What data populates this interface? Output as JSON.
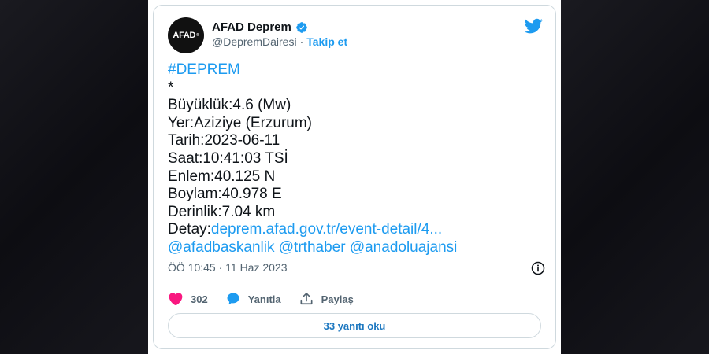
{
  "author": {
    "avatar_text": "AFAD",
    "name": "AFAD Deprem",
    "handle": "@DepremDairesi",
    "separator": "·",
    "follow_label": "Takip et"
  },
  "tweet": {
    "hashtag": "#DEPREM",
    "star": "*",
    "lines": [
      "Büyüklük:4.6 (Mw)",
      "Yer:Aziziye (Erzurum)",
      "Tarih:2023-06-11",
      "Saat:10:41:03 TSİ",
      "Enlem:40.125 N",
      "Boylam:40.978 E",
      "Derinlik:7.04 km"
    ],
    "detail_label": "Detay:",
    "detail_link": "deprem.afad.gov.tr/event-detail/4...",
    "mentions": [
      "@afadbaskanlik",
      "@trthaber",
      "@anadoluajansi"
    ],
    "timestamp": "ÖÖ 10:45 · 11 Haz 2023"
  },
  "actions": {
    "like_count": "302",
    "reply_label": "Yanıtla",
    "share_label": "Paylaş",
    "read_replies_label": "33 yanıtı oku"
  },
  "colors": {
    "accent": "#1d9bf0",
    "like": "#f91880",
    "text": "#0f1419",
    "secondary": "#536471"
  },
  "icons": [
    "verified-badge-icon",
    "twitter-bird-icon",
    "info-icon",
    "heart-icon",
    "reply-bubble-icon",
    "share-icon"
  ]
}
